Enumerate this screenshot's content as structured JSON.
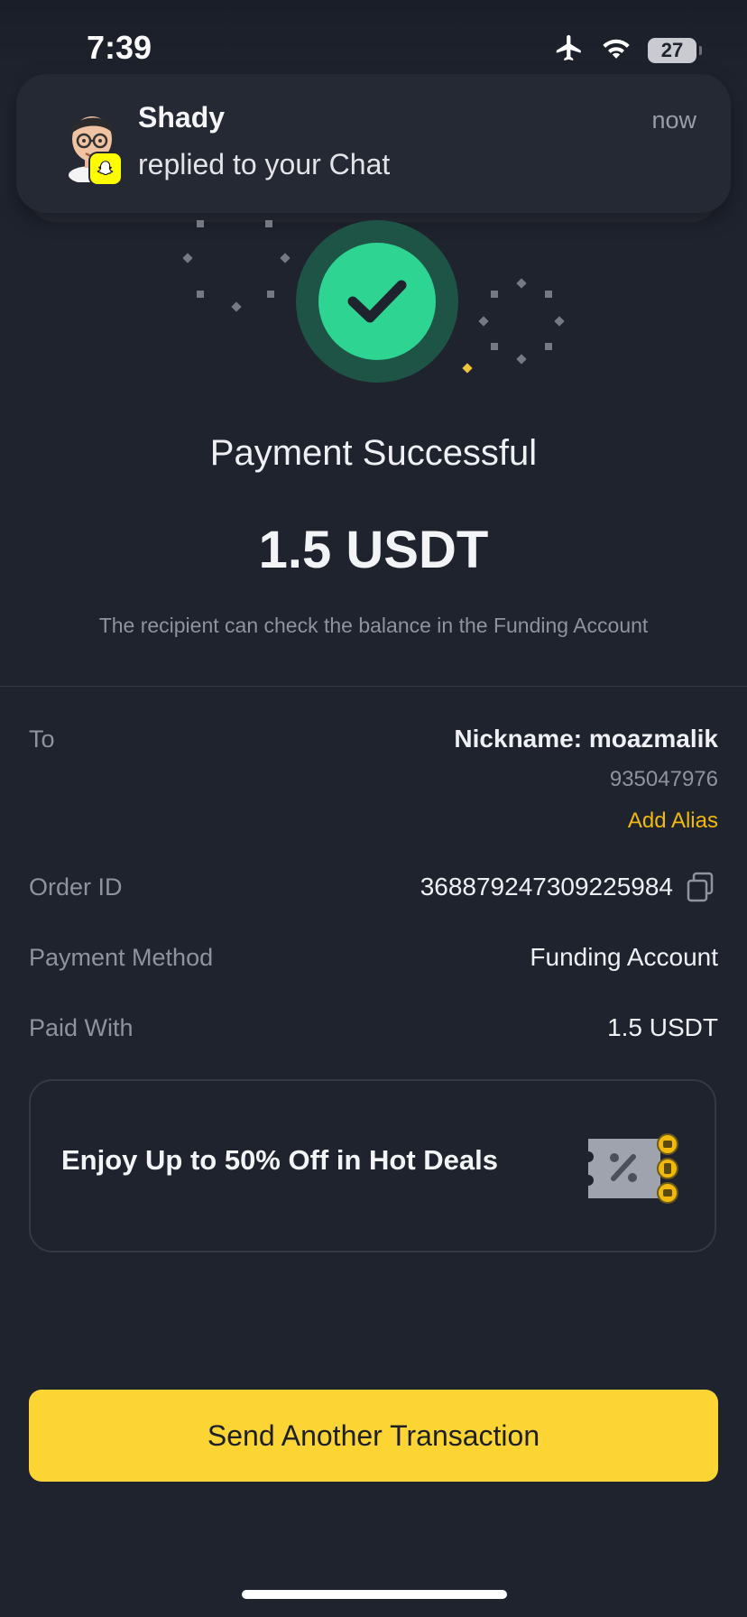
{
  "status_bar": {
    "time": "7:39",
    "battery": "27"
  },
  "notification": {
    "sender": "Shady",
    "message": "replied to your Chat",
    "time": "now"
  },
  "payment": {
    "title": "Payment Successful",
    "amount": "1.5 USDT",
    "subtitle": "The recipient can check the balance in the Funding Account"
  },
  "details": {
    "to_label": "To",
    "to_nickname": "Nickname: moazmalik",
    "to_id": "935047976",
    "add_alias": "Add Alias",
    "order_id_label": "Order ID",
    "order_id": "368879247309225984",
    "payment_method_label": "Payment Method",
    "payment_method": "Funding Account",
    "paid_with_label": "Paid With",
    "paid_with": "1.5 USDT"
  },
  "promo": {
    "text": "Enjoy Up to 50% Off in Hot Deals"
  },
  "cta": {
    "label": "Send Another Transaction"
  },
  "colors": {
    "accent": "#fcd535",
    "success": "#2ed492",
    "background": "#1f232e"
  }
}
